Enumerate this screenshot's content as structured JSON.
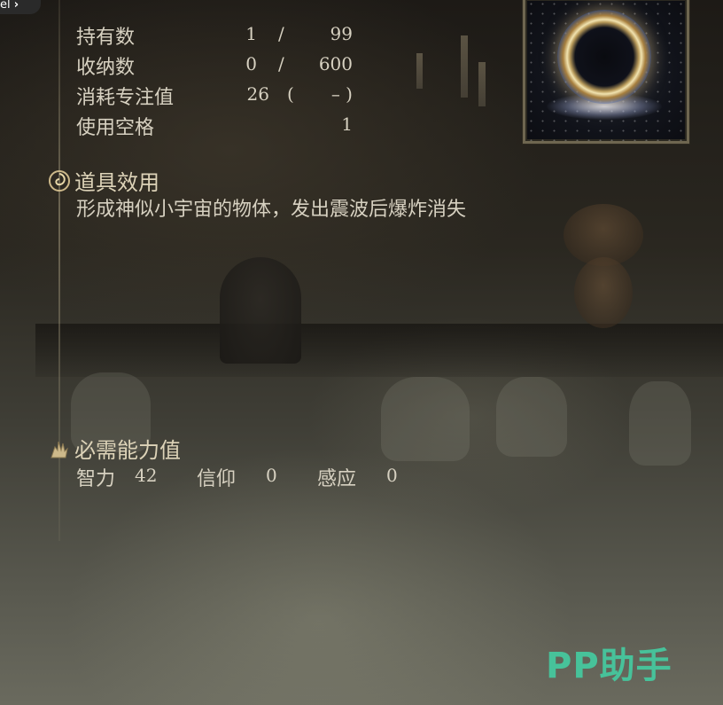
{
  "top_badge": {
    "text": "el",
    "chevron": "›"
  },
  "stats": [
    {
      "label": "持有数",
      "a": "1",
      "sep": "/",
      "b": "99"
    },
    {
      "label": "收纳数",
      "a": "0",
      "sep": "/",
      "b": "600"
    },
    {
      "label": "消耗专注值",
      "a": "26",
      "sep": "(",
      "b": "– )"
    },
    {
      "label": "使用空格",
      "a": "",
      "sep": "",
      "b": "1"
    }
  ],
  "effect": {
    "title": "道具效用",
    "icon": "swirl-icon",
    "description": "形成神似小宇宙的物体，发出震波后爆炸消失"
  },
  "requirements": {
    "title": "必需能力值",
    "icon": "hand-icon",
    "items": [
      {
        "label": "智力",
        "value": "42"
      },
      {
        "label": "信仰",
        "value": "0"
      },
      {
        "label": "感应",
        "value": "0"
      }
    ]
  },
  "watermark": "PP助手",
  "colors": {
    "text": "#d7d1c1",
    "heading": "#ddd3b8",
    "watermark": "#47c29a",
    "frame": "#6e6650"
  }
}
